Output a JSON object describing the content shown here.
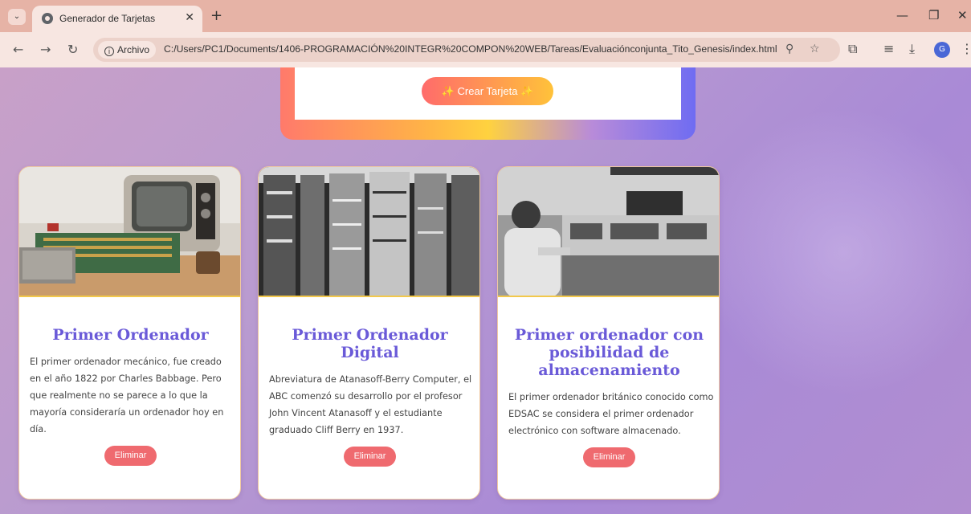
{
  "browser": {
    "tab_title": "Generador de Tarjetas",
    "new_tab": "+",
    "site_chip": "Archivo",
    "url": "C:/Users/PC1/Documents/1406-PROGRAMACIÓN%20INTEGR%20COMPON%20WEB/Tareas/Evaluaciónconjunta_Tito_Genesis/index.html",
    "avatar_letter": "G"
  },
  "form": {
    "create_button": "✨ Crear Tarjeta ✨"
  },
  "cards": [
    {
      "title": "Primer Ordenador",
      "text": "El primer ordenador mecánico, fue creado en el año 1822 por Charles Babbage. Pero que realmente no se parece a lo que la mayoría consideraría un ordenador hoy en día.",
      "delete_label": "Eliminar"
    },
    {
      "title": "Primer Ordenador Digital",
      "text": "Abreviatura de Atanasoff-Berry Computer, el ABC comenzó su desarrollo por el profesor John Vincent Atanasoff y el estudiante graduado Cliff Berry en 1937.",
      "delete_label": "Eliminar"
    },
    {
      "title": "Primer ordenador con posibilidad de almacenamiento",
      "text": "El primer ordenador británico conocido como EDSAC se considera el primer ordenador electrónico con software almacenado.",
      "delete_label": "Eliminar"
    }
  ],
  "colors": {
    "card_title": "#6a5ad8",
    "delete_button": "#ef6a6f",
    "page_background": "#b99bd0"
  }
}
